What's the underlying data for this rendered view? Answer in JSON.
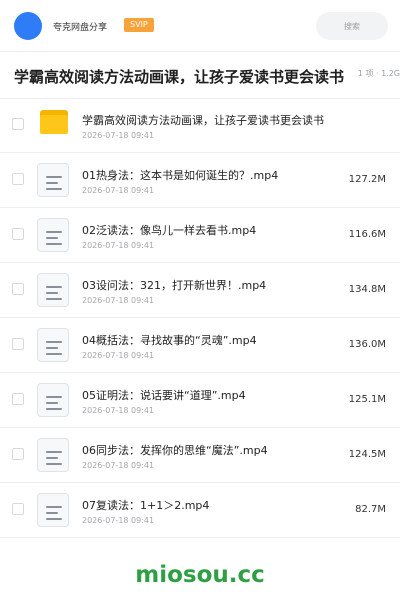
{
  "header": {
    "username": "夸克网盘分享",
    "badge": "SVIP",
    "search_placeholder": "搜索",
    "brand_color": "#2e7cf6"
  },
  "folder": {
    "title": "学霸高效阅读方法动画课，让孩子爱读书更会读书",
    "meta": "1 项 · 1.2G"
  },
  "files": [
    {
      "type": "folder",
      "name": "学霸高效阅读方法动画课，让孩子爱读书更会读书",
      "date": "2026-07-18 09:41",
      "size": ""
    },
    {
      "type": "file",
      "name": "01热身法：这本书是如何诞生的？.mp4",
      "date": "2026-07-18 09:41",
      "size": "127.2M"
    },
    {
      "type": "file",
      "name": "02泛读法：像鸟儿一样去看书.mp4",
      "date": "2026-07-18 09:41",
      "size": "116.6M"
    },
    {
      "type": "file",
      "name": "03设问法：321，打开新世界！.mp4",
      "date": "2026-07-18 09:41",
      "size": "134.8M"
    },
    {
      "type": "file",
      "name": "04概括法：寻找故事的“灵魂”.mp4",
      "date": "2026-07-18 09:41",
      "size": "136.0M"
    },
    {
      "type": "file",
      "name": "05证明法：说话要讲“道理”.mp4",
      "date": "2026-07-18 09:41",
      "size": "125.1M"
    },
    {
      "type": "file",
      "name": "06同步法：发挥你的思维“魔法”.mp4",
      "date": "2026-07-18 09:41",
      "size": "124.5M"
    },
    {
      "type": "file",
      "name": "07复读法：1+1＞2.mp4",
      "date": "2026-07-18 09:41",
      "size": "82.7M"
    }
  ],
  "watermark": "miosou.cc"
}
